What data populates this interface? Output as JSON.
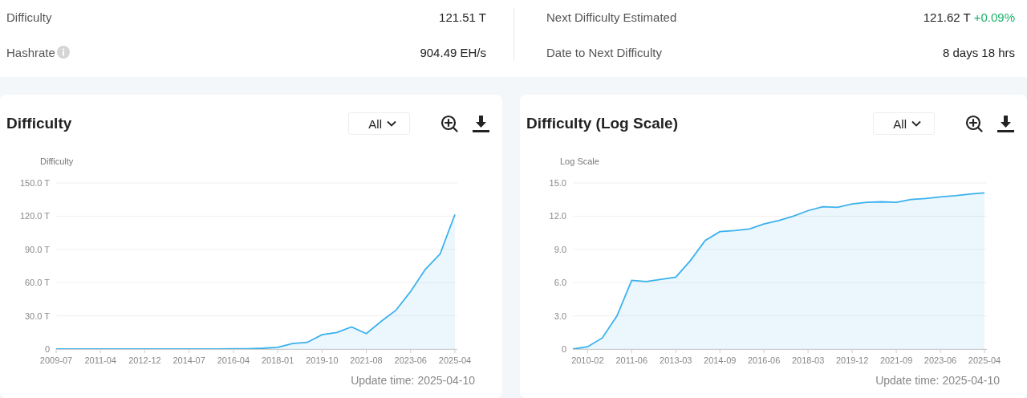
{
  "stats": {
    "left": [
      {
        "label": "Difficulty",
        "value": "121.51 T",
        "info": false
      },
      {
        "label": "Hashrate",
        "value": "904.49 EH/s",
        "info": true
      }
    ],
    "right": [
      {
        "label": "Next Difficulty Estimated",
        "value": "121.62 T",
        "change": "+0.09%",
        "info": false
      },
      {
        "label": "Date to Next Difficulty",
        "value": "8 days 18 hrs",
        "info": false
      }
    ]
  },
  "charts": [
    {
      "title": "Difficulty",
      "range": "All",
      "update_time": "Update time: 2025-04-10",
      "chart_data": {
        "type": "area",
        "grid": true,
        "ylabel": "Difficulty",
        "ylim": [
          0,
          150
        ],
        "yticks": [
          {
            "value": 0,
            "label": "0"
          },
          {
            "value": 30,
            "label": "30.0 T"
          },
          {
            "value": 60,
            "label": "60.0 T"
          },
          {
            "value": 90,
            "label": "90.0 T"
          },
          {
            "value": 120,
            "label": "120.0 T"
          },
          {
            "value": 150,
            "label": "150.0 T"
          }
        ],
        "categories": [
          "2009-07",
          null,
          null,
          "2011-04",
          null,
          null,
          "2012-12",
          null,
          null,
          "2014-07",
          null,
          null,
          "2016-04",
          null,
          null,
          "2018-01",
          null,
          null,
          "2019-10",
          null,
          null,
          "2021-08",
          null,
          null,
          "2023-06",
          null,
          null,
          "2025-04"
        ],
        "series": [
          {
            "color": "#3bb1ee",
            "values": [
              0,
              0,
              0,
              0,
              0,
              0,
              0,
              0,
              0,
              0,
              0,
              0,
              0.2,
              0.3,
              0.7,
              1.5,
              5,
              6,
              13,
              15,
              20,
              14,
              25,
              35,
              52,
              72,
              86,
              121.5
            ]
          }
        ]
      }
    },
    {
      "title": "Difficulty (Log Scale)",
      "range": "All",
      "update_time": "Update time: 2025-04-10",
      "chart_data": {
        "type": "area",
        "grid": true,
        "ylabel": "Log Scale",
        "ylim": [
          0,
          15
        ],
        "yticks": [
          {
            "value": 0,
            "label": "0"
          },
          {
            "value": 3,
            "label": "3.0"
          },
          {
            "value": 6,
            "label": "6.0"
          },
          {
            "value": 9,
            "label": "9.0"
          },
          {
            "value": 12,
            "label": "12.0"
          },
          {
            "value": 15,
            "label": "15.0"
          }
        ],
        "categories": [
          null,
          "2010-02",
          null,
          null,
          "2011-06",
          null,
          null,
          "2013-03",
          null,
          null,
          "2014-09",
          null,
          null,
          "2016-06",
          null,
          null,
          "2018-03",
          null,
          null,
          "2019-12",
          null,
          null,
          "2021-09",
          null,
          null,
          "2023-06",
          null,
          null,
          "2025-04"
        ],
        "series": [
          {
            "color": "#3bb1ee",
            "values": [
              0,
              0.2,
              1.0,
              3.0,
              6.2,
              6.1,
              6.3,
              6.5,
              8.0,
              9.8,
              10.6,
              10.7,
              10.85,
              11.3,
              11.6,
              12.0,
              12.5,
              12.85,
              12.8,
              13.1,
              13.25,
              13.3,
              13.25,
              13.5,
              13.6,
              13.75,
              13.85,
              14.0,
              14.1
            ]
          }
        ]
      }
    }
  ]
}
